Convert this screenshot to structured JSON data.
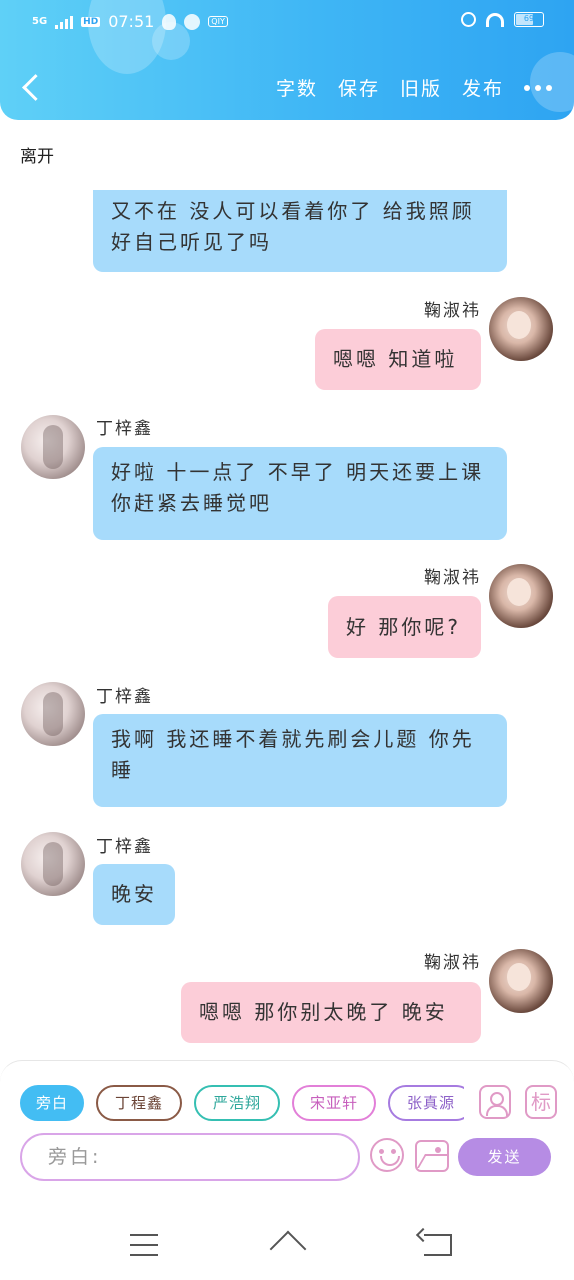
{
  "status_bar": {
    "network": "5G",
    "hd": "HD",
    "time": "07:51",
    "app_badge": "QIY",
    "battery": "69"
  },
  "header": {
    "actions": [
      "字数",
      "保存",
      "旧版",
      "发布"
    ]
  },
  "scene_label": "离开",
  "messages": [
    {
      "side": "left",
      "speaker": "",
      "text": "又不在 没人可以看着你了 给我照顾好自己听见了吗",
      "color": "blue"
    },
    {
      "side": "right",
      "speaker": "鞠淑祎",
      "text": "嗯嗯 知道啦",
      "color": "pink"
    },
    {
      "side": "left",
      "speaker": "丁梓鑫",
      "text": "好啦 十一点了 不早了 明天还要上课你赶紧去睡觉吧",
      "color": "blue"
    },
    {
      "side": "right",
      "speaker": "鞠淑祎",
      "text": "好 那你呢?",
      "color": "pink"
    },
    {
      "side": "left",
      "speaker": "丁梓鑫",
      "text": "我啊 我还睡不着就先刷会儿题 你先睡",
      "color": "blue"
    },
    {
      "side": "left",
      "speaker": "丁梓鑫",
      "text": "晚安",
      "color": "blue"
    },
    {
      "side": "right",
      "speaker": "鞠淑祎",
      "text": "嗯嗯 那你别太晚了 晚安",
      "color": "pink"
    }
  ],
  "composer": {
    "roles": [
      "旁白",
      "丁程鑫",
      "严浩翔",
      "宋亚轩",
      "张真源"
    ],
    "tag_icon_label": "标",
    "input_placeholder": "旁白:",
    "send_label": "发送"
  },
  "colors": {
    "header": "#3fb6f5",
    "left_bubble": "#a7dbfb",
    "right_bubble": "#fccdd8",
    "send": "#b68ce4"
  }
}
